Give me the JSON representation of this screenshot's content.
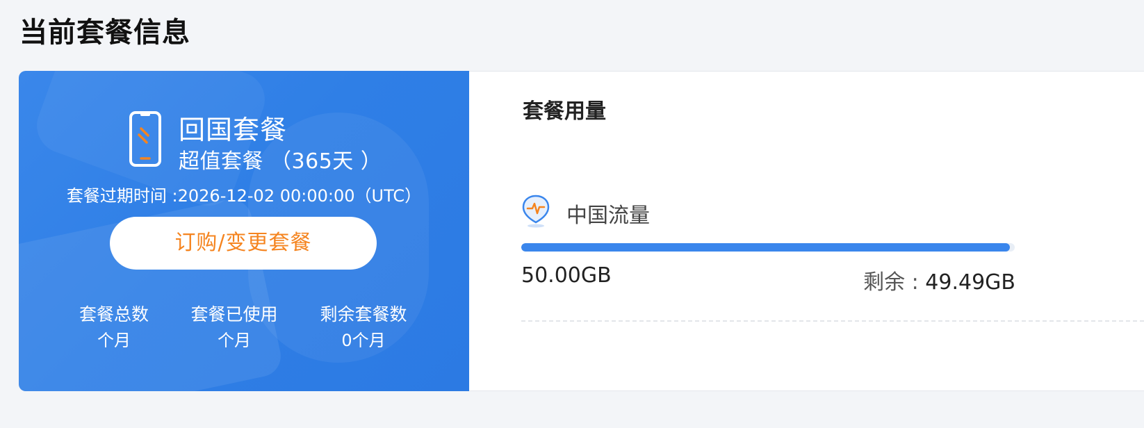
{
  "page": {
    "title": "当前套餐信息"
  },
  "plan": {
    "name": "回国套餐",
    "subtitle": "超值套餐 （365天 ）",
    "expiry": "套餐过期时间 :2026-12-02 00:00:00（UTC）",
    "change_button_label": "订购/变更套餐",
    "stats": [
      {
        "label": "套餐总数",
        "value": "个月"
      },
      {
        "label": "套餐已使用",
        "value": "个月"
      },
      {
        "label": "剩余套餐数",
        "value": "0个月"
      }
    ],
    "icon": "phone-icon"
  },
  "usage": {
    "title": "套餐用量",
    "item": {
      "icon": "traffic-shield-icon",
      "label": "中国流量",
      "total": "50.00GB",
      "remaining_label": "剩余 : ",
      "remaining_value": "49.49GB",
      "progress_fraction": 0.99
    }
  },
  "colors": {
    "primary_blue": "#2f7fe6",
    "accent_orange": "#f5841f",
    "progress_blue": "#3a86ec",
    "background": "#f3f5f8"
  }
}
